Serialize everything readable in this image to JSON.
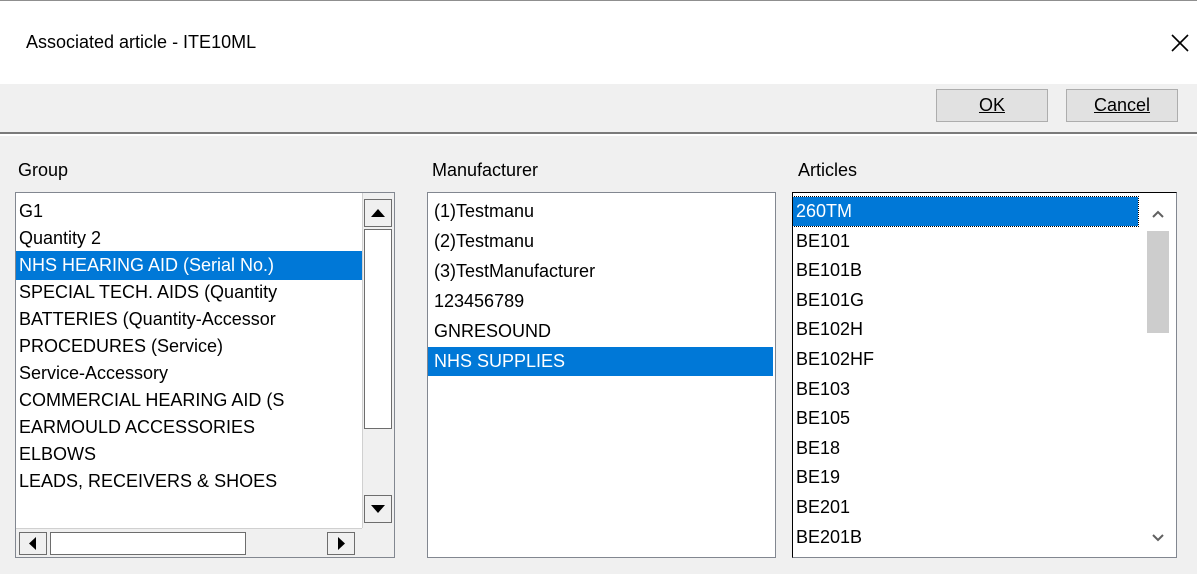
{
  "window": {
    "title": "Associated article - ITE10ML",
    "close_glyph": "✕"
  },
  "toolbar": {
    "ok_label": "OK",
    "cancel_label": "Cancel"
  },
  "group": {
    "label": "Group",
    "items": [
      "G1",
      "Quantity 2",
      "NHS HEARING AID (Serial No.)",
      "SPECIAL TECH. AIDS (Quantity",
      "BATTERIES (Quantity-Accessor",
      "PROCEDURES (Service)",
      "Service-Accessory",
      "COMMERCIAL HEARING AID (S",
      "EARMOULD ACCESSORIES",
      "ELBOWS",
      "LEADS, RECEIVERS & SHOES"
    ],
    "selected_index": 2
  },
  "manufacturer": {
    "label": "Manufacturer",
    "items": [
      "(1)Testmanu",
      "(2)Testmanu",
      "(3)TestManufacturer",
      "123456789",
      "GNRESOUND",
      "NHS SUPPLIES"
    ],
    "selected_index": 5
  },
  "articles": {
    "label": "Articles",
    "items": [
      "260TM",
      "BE101",
      "BE101B",
      "BE101G",
      "BE102H",
      "BE102HF",
      "BE103",
      "BE105",
      "BE18",
      "BE19",
      "BE201",
      "BE201B"
    ],
    "selected_index": 0
  },
  "colors": {
    "selection": "#0078d7",
    "selection_text": "#ffffff"
  }
}
